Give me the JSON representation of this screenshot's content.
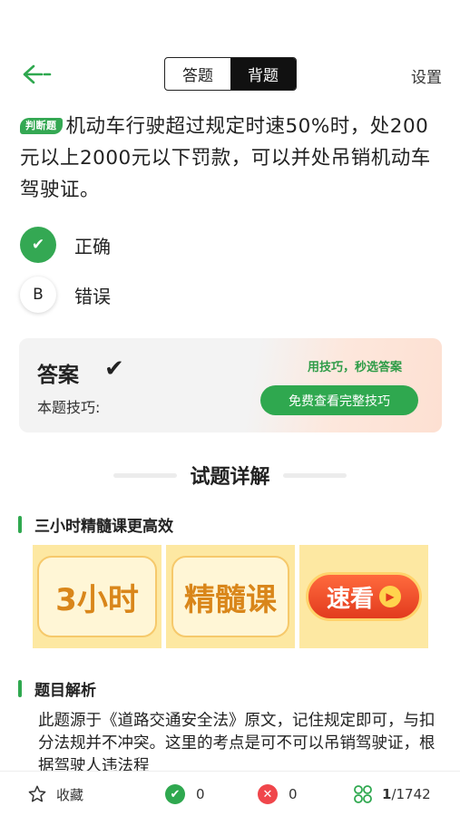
{
  "header": {
    "tabs": [
      {
        "label": "答题",
        "active": false
      },
      {
        "label": "背题",
        "active": true
      }
    ],
    "settings_label": "设置",
    "back_icon": "back-arrow-icon"
  },
  "question": {
    "tag": "判断题",
    "text": "机动车行驶超过规定时速50%时，处200元以上2000元以下罚款，可以并处吊销机动车驾驶证。"
  },
  "options": [
    {
      "marker": "✔",
      "label": "正确",
      "selected": true
    },
    {
      "marker": "B",
      "label": "错误",
      "selected": false
    }
  ],
  "answer_card": {
    "title": "答案",
    "answer_mark": "✔",
    "tip_label": "本题技巧:",
    "hint": "用技巧，秒选答案",
    "button_label": "免费查看完整技巧"
  },
  "section": {
    "title": "试题详解"
  },
  "course": {
    "heading": "三小时精髓课更高效",
    "banners": [
      {
        "text": "3小时"
      },
      {
        "text": "精髓课"
      },
      {
        "text": "速看"
      }
    ]
  },
  "analysis": {
    "heading": "题目解析",
    "text": "此题源于《道路交通安全法》原文，记住规定即可，与扣分法规并不冲突。这里的考点是可不可以吊销驾驶证，根据驾驶人违法程"
  },
  "bottom_bar": {
    "favorite_label": "收藏",
    "correct_count": "0",
    "wrong_count": "0",
    "progress_current": "1",
    "progress_total": "/1742"
  },
  "colors": {
    "accent_green": "#2fa84f",
    "wrong_red": "#f0464b",
    "banner_yellow": "#fde8a2"
  }
}
